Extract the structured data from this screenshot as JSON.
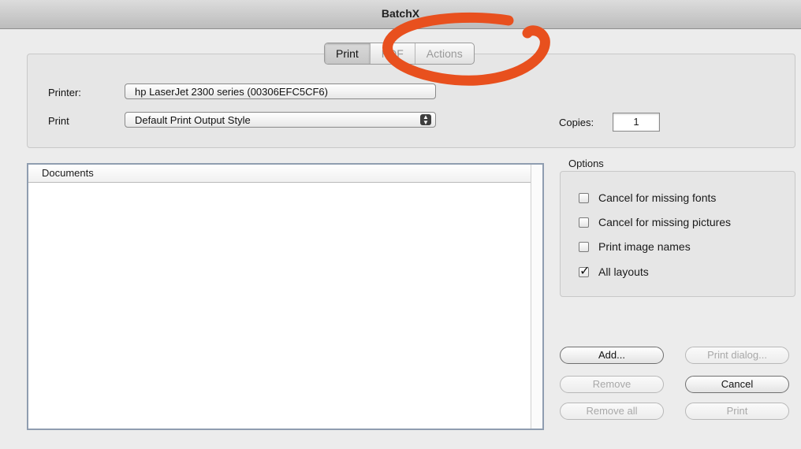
{
  "window": {
    "title": "BatchX"
  },
  "tabs": [
    {
      "label": "Print",
      "active": true
    },
    {
      "label": "PDF",
      "active": false
    },
    {
      "label": "Actions",
      "active": false
    }
  ],
  "printer": {
    "label": "Printer:",
    "value": "hp LaserJet 2300 series (00306EFC5CF6)"
  },
  "print_style": {
    "label": "Print",
    "value": "Default Print Output Style"
  },
  "copies": {
    "label": "Copies:",
    "value": "1"
  },
  "documents": {
    "header": "Documents",
    "items": []
  },
  "options": {
    "title": "Options",
    "items": [
      {
        "label": "Cancel for missing fonts",
        "checked": false
      },
      {
        "label": "Cancel for missing pictures",
        "checked": false
      },
      {
        "label": "Print image names",
        "checked": false
      },
      {
        "label": "All layouts",
        "checked": true
      }
    ]
  },
  "buttons": {
    "add": "Add...",
    "remove": "Remove",
    "remove_all": "Remove all",
    "print_dialog": "Print dialog...",
    "cancel": "Cancel",
    "print": "Print"
  },
  "annotation_color": "#e8501e"
}
